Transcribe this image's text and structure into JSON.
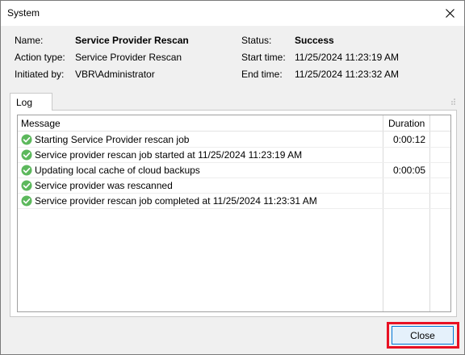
{
  "window": {
    "title": "System"
  },
  "summary": {
    "name_label": "Name:",
    "name_value": "Service Provider Rescan",
    "action_type_label": "Action type:",
    "action_type_value": "Service Provider Rescan",
    "initiated_by_label": "Initiated by:",
    "initiated_by_value": "VBR\\Administrator",
    "status_label": "Status:",
    "status_value": "Success",
    "start_time_label": "Start time:",
    "start_time_value": "11/25/2024 11:23:19 AM",
    "end_time_label": "End time:",
    "end_time_value": "11/25/2024 11:23:32 AM"
  },
  "tabs": [
    {
      "label": "Log"
    }
  ],
  "log": {
    "columns": {
      "message": "Message",
      "duration": "Duration"
    },
    "rows": [
      {
        "status": "success",
        "message": "Starting Service Provider rescan job",
        "duration": "0:00:12"
      },
      {
        "status": "success",
        "message": "Service provider rescan job started at 11/25/2024 11:23:19 AM",
        "duration": ""
      },
      {
        "status": "success",
        "message": "Updating local cache of cloud backups",
        "duration": "0:00:05"
      },
      {
        "status": "success",
        "message": "Service provider was rescanned",
        "duration": ""
      },
      {
        "status": "success",
        "message": "Service provider rescan job completed at 11/25/2024 11:23:31 AM",
        "duration": ""
      }
    ]
  },
  "footer": {
    "close_label": "Close"
  },
  "colors": {
    "success": "#5cb85c",
    "highlight": "#e81123",
    "button_border": "#0078d7"
  },
  "icons": {
    "row_status": "check-circle-icon",
    "window_close": "close-icon"
  }
}
